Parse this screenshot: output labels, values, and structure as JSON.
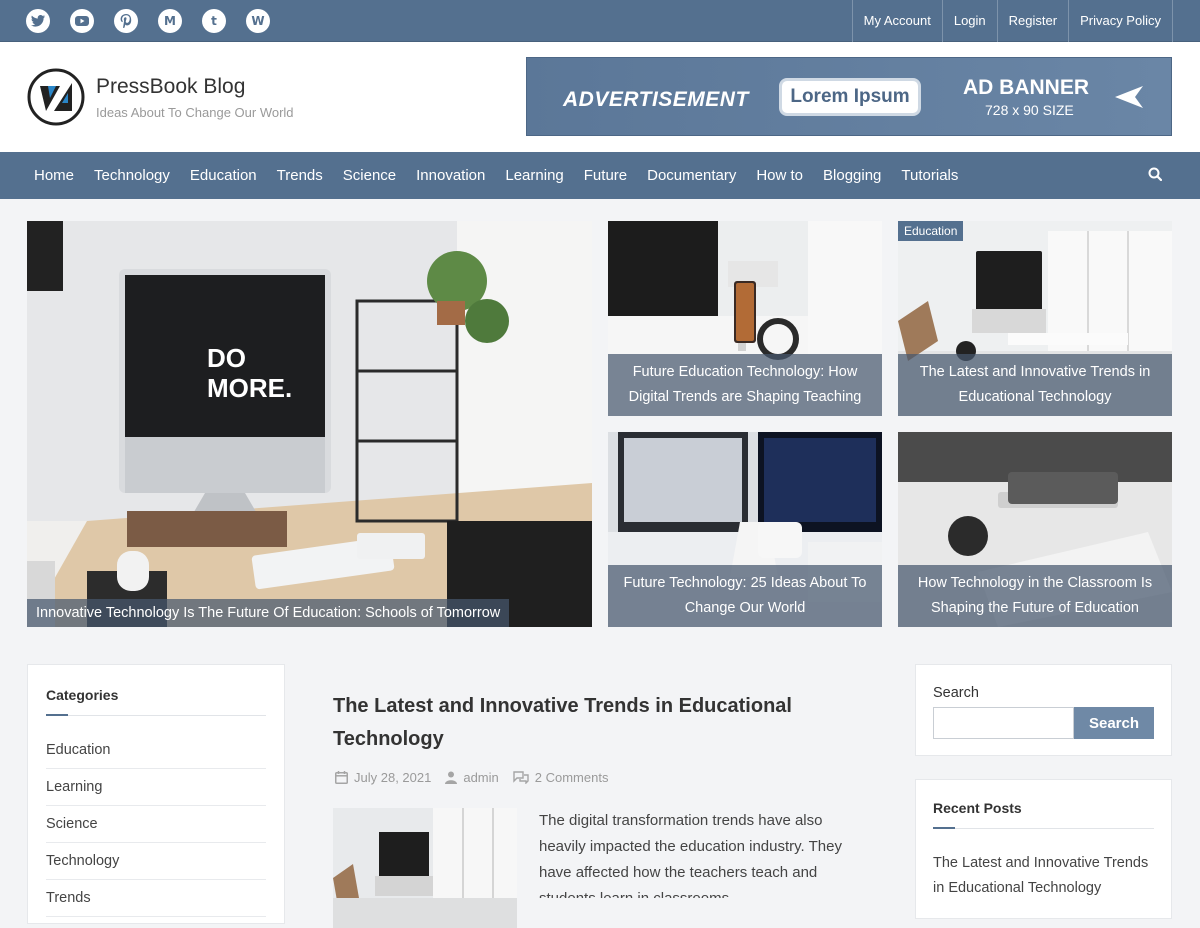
{
  "topbar": {
    "social": [
      {
        "icon": "twitter-icon"
      },
      {
        "icon": "youtube-icon"
      },
      {
        "icon": "pinterest-icon"
      },
      {
        "icon": "medium-icon",
        "glyph": "M"
      },
      {
        "icon": "tumblr-icon",
        "glyph": "t"
      },
      {
        "icon": "wordpress-icon",
        "glyph": "W"
      }
    ],
    "links": [
      "My Account",
      "Login",
      "Register",
      "Privacy Policy"
    ]
  },
  "header": {
    "brand_name": "PressBook Blog",
    "tagline": "Ideas About To Change Our World",
    "ad": {
      "text": "ADVERTISEMENT",
      "pill": "Lorem Ipsum",
      "big": "AD BANNER",
      "size": "728 x 90 SIZE"
    }
  },
  "nav": {
    "items": [
      "Home",
      "Technology",
      "Education",
      "Trends",
      "Science",
      "Innovation",
      "Learning",
      "Future",
      "Documentary",
      "How to",
      "Blogging",
      "Tutorials"
    ],
    "search_icon": "search-icon"
  },
  "hero": {
    "big": {
      "caption": "Innovative Technology Is The Future Of Education: Schools of Tomorrow",
      "screen_text_1": "DO",
      "screen_text_2": "MORE."
    },
    "tiles": [
      {
        "caption": "Future Education Technology: How Digital Trends are Shaping Teaching",
        "badge": ""
      },
      {
        "caption": "The Latest and Innovative Trends in Educational Technology",
        "badge": "Education"
      },
      {
        "caption": "Future Technology: 25 Ideas About To Change Our World",
        "badge": ""
      },
      {
        "caption": "How Technology in the Classroom Is Shaping the Future of Education",
        "badge": ""
      }
    ]
  },
  "categories": {
    "title": "Categories",
    "items": [
      "Education",
      "Learning",
      "Science",
      "Technology",
      "Trends"
    ]
  },
  "post": {
    "title": "The Latest and Innovative Trends in Educational Technology",
    "date": "July 28, 2021",
    "author": "admin",
    "comments": "2 Comments",
    "excerpt": "The digital transformation trends have also heavily impacted the education industry. They have affected how the teachers teach and students learn in classrooms."
  },
  "search_widget": {
    "title": "Search",
    "button": "Search",
    "value": ""
  },
  "recent_posts": {
    "title": "Recent Posts",
    "items": [
      "The Latest and Innovative Trends in Educational Technology"
    ]
  },
  "colors": {
    "primary": "#54708f",
    "button": "#6f89a6"
  }
}
